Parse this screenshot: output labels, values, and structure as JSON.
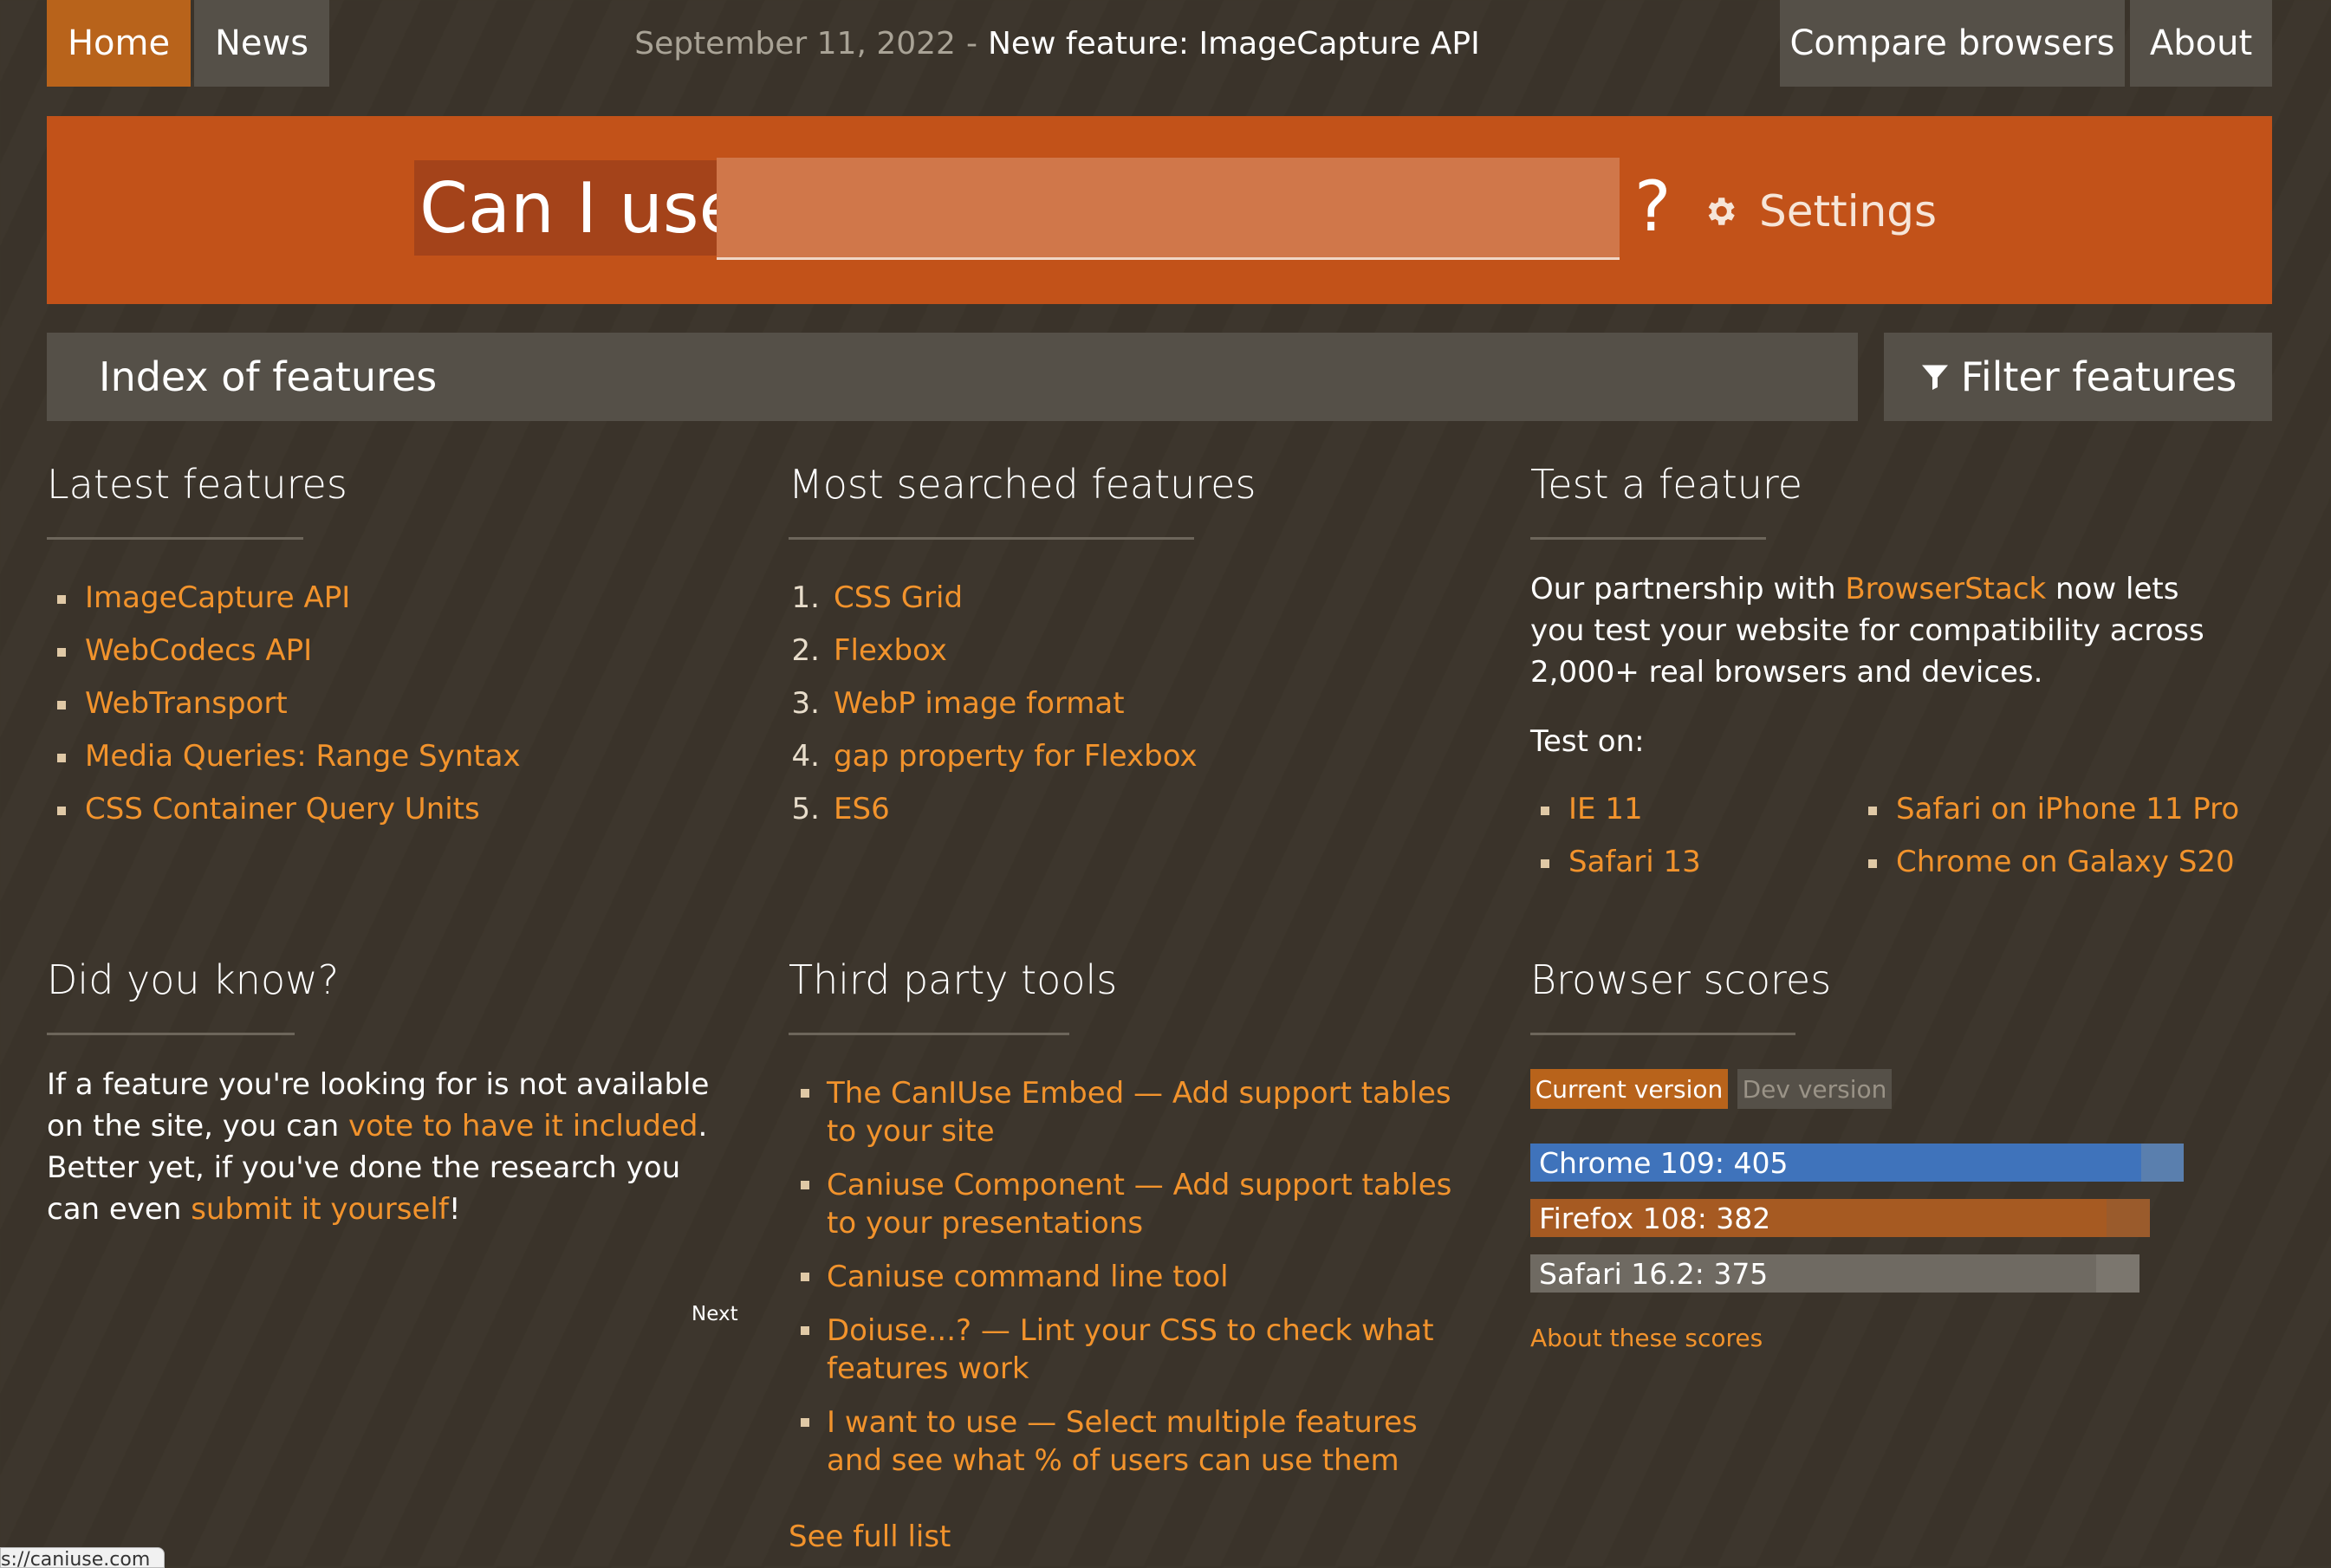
{
  "nav": {
    "home": "Home",
    "news": "News",
    "compare": "Compare browsers",
    "about": "About",
    "news_date": "September 11, 2022",
    "news_sep": "-",
    "news_headline": "New feature: ImageCapture API"
  },
  "hero": {
    "label": "Can I use",
    "input_value": "",
    "input_placeholder": "",
    "question": "?",
    "settings": "Settings"
  },
  "index_bar": {
    "title": "Index of features",
    "filter": "Filter features"
  },
  "latest": {
    "title": "Latest features",
    "items": [
      "ImageCapture API",
      "WebCodecs API",
      "WebTransport",
      "Media Queries: Range Syntax",
      "CSS Container Query Units"
    ]
  },
  "most_searched": {
    "title": "Most searched features",
    "items": [
      {
        "num": "1.",
        "label": "CSS Grid"
      },
      {
        "num": "2.",
        "label": "Flexbox"
      },
      {
        "num": "3.",
        "label": "WebP image format"
      },
      {
        "num": "4.",
        "label": "gap property for Flexbox"
      },
      {
        "num": "5.",
        "label": "ES6"
      }
    ]
  },
  "test_feature": {
    "title": "Test a feature",
    "text_before": "Our partnership with ",
    "link": "BrowserStack",
    "text_after": " now lets you test your website for compatibility across 2,000+ real browsers and devices.",
    "test_on": "Test on:",
    "left_items": [
      "IE 11",
      "Safari 13"
    ],
    "right_items": [
      "Safari on iPhone 11 Pro",
      "Chrome on Galaxy S20"
    ]
  },
  "did_you_know": {
    "title": "Did you know?",
    "t1": "If a feature you're looking for is not available on the site, you can ",
    "link1": "vote to have it included",
    "t2": ". Better yet, if you've done the research you can even ",
    "link2": "submit it yourself",
    "t3": "!",
    "next": "Next"
  },
  "third_party": {
    "title": "Third party tools",
    "items": [
      "The CanIUse Embed — Add support tables to your site",
      "Caniuse Component — Add support tables to your presentations",
      "Caniuse command line tool",
      "Doiuse...? — Lint your CSS to check what features work",
      "I want to use — Select multiple features and see what % of users can use them"
    ],
    "see_full": "See full list"
  },
  "browser_scores": {
    "title": "Browser scores",
    "tab_current": "Current version",
    "tab_dev": "Dev version",
    "scores": [
      {
        "label": "Chrome 109: 405",
        "value": 405,
        "color": "#3f73bb",
        "track": "#5a7fae"
      },
      {
        "label": "Firefox 108: 382",
        "value": 382,
        "color": "#a65a22",
        "track": "#9a5b2c"
      },
      {
        "label": "Safari 16.2: 375",
        "value": 375,
        "color": "#6f6a62",
        "track": "#7b766e"
      }
    ],
    "about": "About these scores"
  },
  "status_bar": {
    "url": "s://caniuse.com"
  },
  "colors": {
    "background": "#3b342a",
    "accent": "#c25219",
    "link": "#f2932c",
    "nav_active": "#b8631b",
    "nav_bg": "#555048"
  }
}
